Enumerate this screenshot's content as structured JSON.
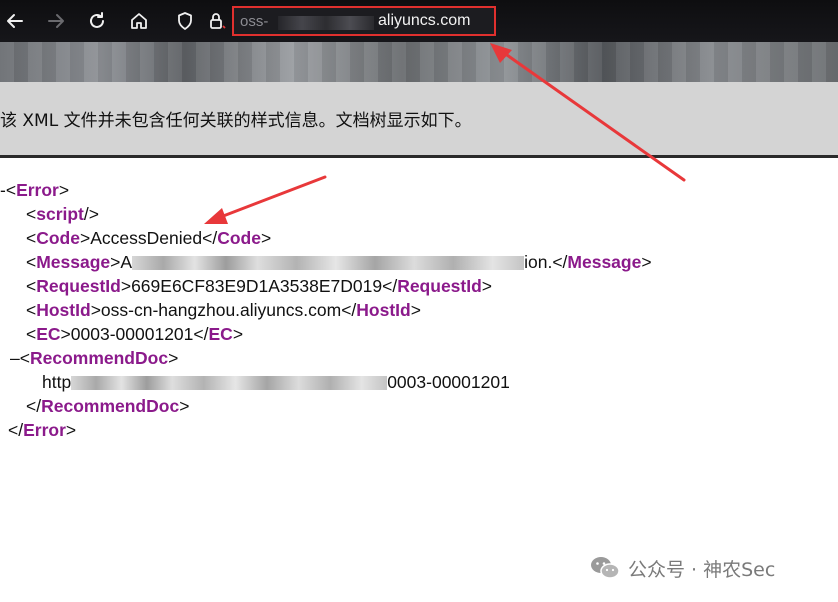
{
  "toolbar": {
    "icons": [
      "back-arrow-icon",
      "forward-arrow-icon",
      "reload-icon",
      "home-icon",
      "shield-icon",
      "lock-icon"
    ],
    "url_prefix": "oss-",
    "url_domain": "aliyuncs.com"
  },
  "info_bar": {
    "text": "该 XML 文件并未包含任何关联的样式信息。文档树显示如下。"
  },
  "xml": {
    "root_toggle": "-",
    "error_tag": "Error",
    "script_tag": "script",
    "code_tag": "Code",
    "code_value": "AccessDenied",
    "message_tag": "Message",
    "message_start": "A",
    "message_end": "ion.",
    "request_tag": "RequestId",
    "request_value": "669E6CF83E9D1A3538E7D019",
    "host_tag": "HostId",
    "host_value": "oss-cn-hangzhou.aliyuncs.com",
    "ec_tag": "EC",
    "ec_value": "0003-00001201",
    "recommend_toggle": "–",
    "recommend_tag": "RecommendDoc",
    "recommend_start": "http",
    "recommend_end": "0003-00001201"
  },
  "annotation_colors": {
    "arrow": "#e8383a",
    "box": "#e0302e",
    "tag": "#8b1a8b"
  },
  "watermark": {
    "icon": "wechat-icon",
    "text": "公众号 · 神农Sec"
  }
}
